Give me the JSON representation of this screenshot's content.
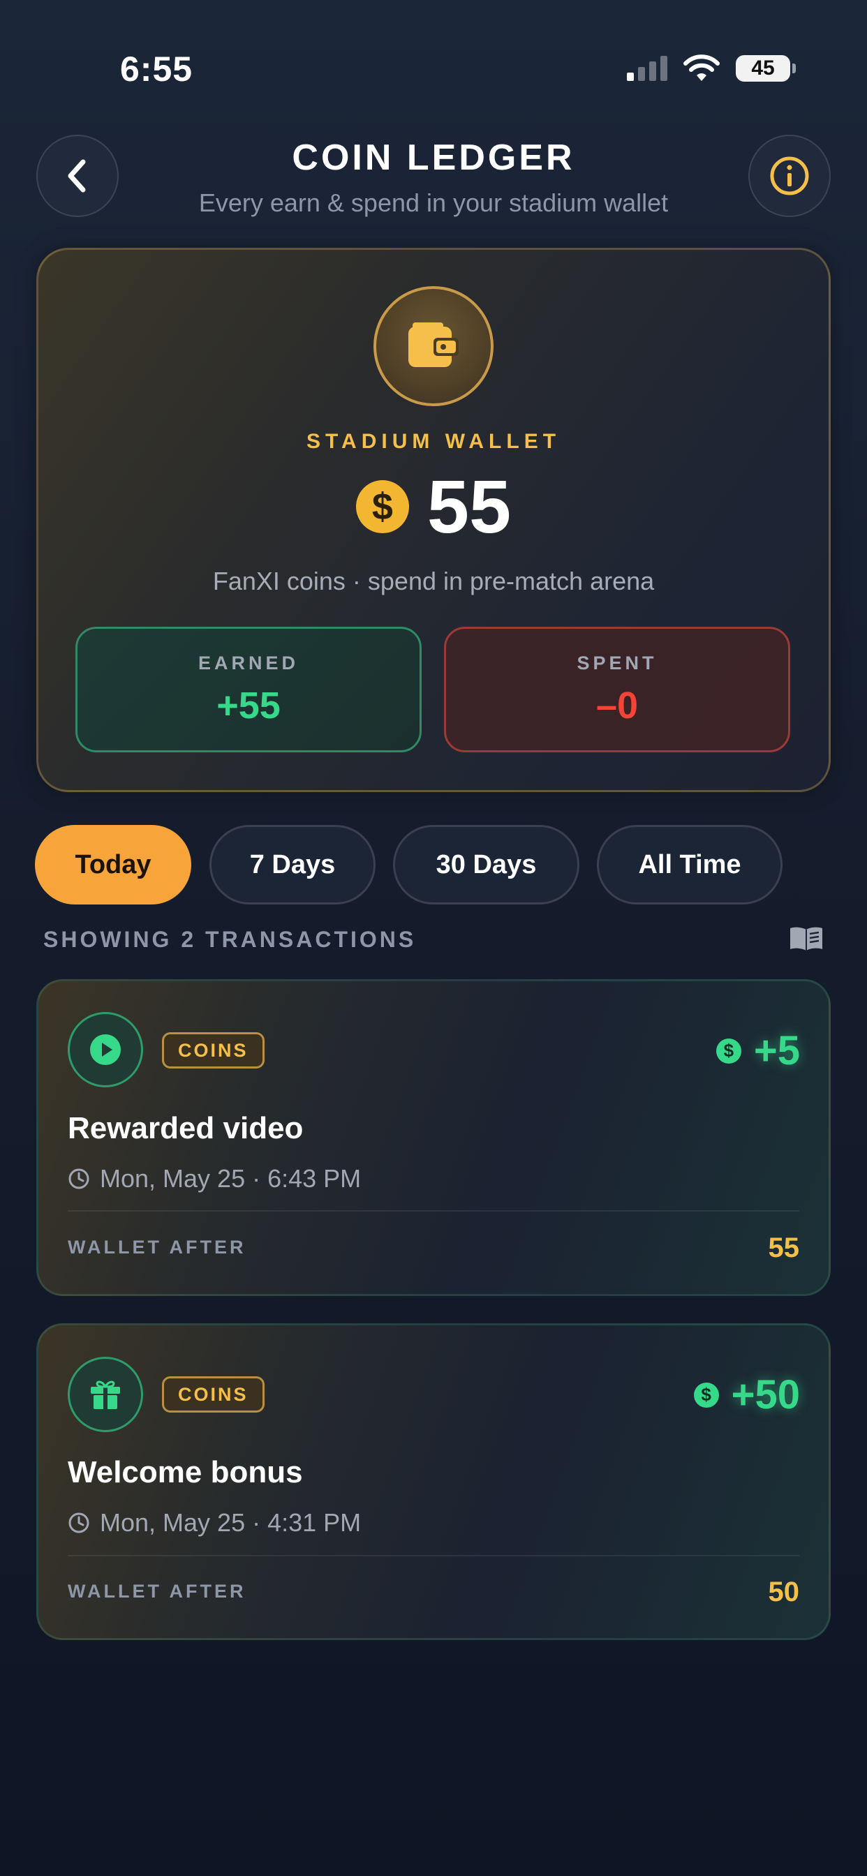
{
  "status_bar": {
    "time": "6:55",
    "battery": "45"
  },
  "header": {
    "title": "COIN LEDGER",
    "subtitle": "Every earn & spend in your stadium wallet"
  },
  "wallet": {
    "label": "STADIUM WALLET",
    "coin_symbol": "$",
    "balance": "55",
    "caption": "FanXI coins · spend in pre-match arena",
    "earned_label": "EARNED",
    "earned_value": "+55",
    "spent_label": "SPENT",
    "spent_value": "–0"
  },
  "filters": {
    "items": [
      {
        "label": "Today",
        "active": true
      },
      {
        "label": "7 Days",
        "active": false
      },
      {
        "label": "30 Days",
        "active": false
      },
      {
        "label": "All Time",
        "active": false
      }
    ]
  },
  "list": {
    "count_text": "SHOWING 2 TRANSACTIONS"
  },
  "transactions": [
    {
      "icon": "play-icon",
      "badge": "COINS",
      "coin_symbol": "$",
      "amount": "+5",
      "title": "Rewarded video",
      "time": "Mon, May 25 · 6:43 PM",
      "wallet_after_label": "WALLET AFTER",
      "wallet_after": "55"
    },
    {
      "icon": "gift-icon",
      "badge": "COINS",
      "coin_symbol": "$",
      "amount": "+50",
      "title": "Welcome bonus",
      "time": "Mon, May 25 · 4:31 PM",
      "wallet_after_label": "WALLET AFTER",
      "wallet_after": "50"
    }
  ],
  "colors": {
    "accent_gold": "#f5bf4a",
    "earn_green": "#36d98a",
    "spend_red": "#f24537",
    "active_chip": "#f7a43a"
  }
}
